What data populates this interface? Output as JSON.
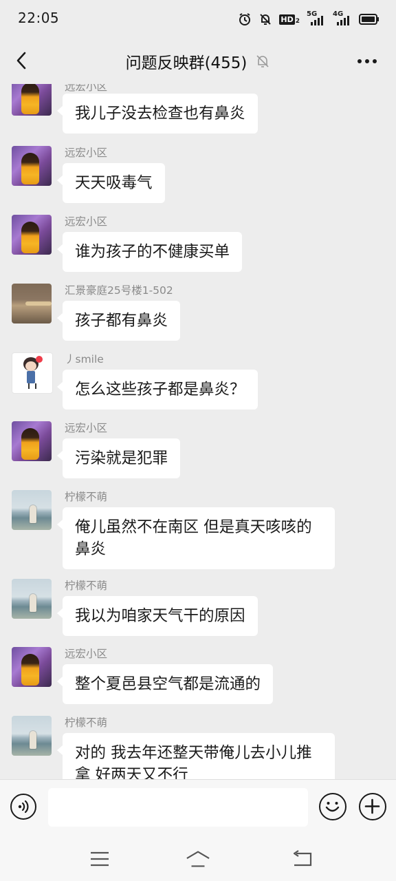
{
  "status_bar": {
    "time": "22:05",
    "icons": [
      "alarm-icon",
      "mute-bell-icon",
      "hd-icon",
      "signal-5g-icon",
      "signal-4g-icon",
      "battery-icon"
    ],
    "hd_label": "HD",
    "hd_sub": "2",
    "net1_label": "5G",
    "net2_label": "4G"
  },
  "header": {
    "title": "问题反映群(455)",
    "muted_icon": "bell-muted-icon",
    "back_icon": "chevron-left-icon",
    "more_icon": "more-dots-icon"
  },
  "messages": [
    {
      "sender": "远宏小区",
      "text": "我儿子没去检查也有鼻炎",
      "avatar": "yuanhong"
    },
    {
      "sender": "远宏小区",
      "text": "天天吸毒气",
      "avatar": "yuanhong"
    },
    {
      "sender": "远宏小区",
      "text": "谁为孩子的不健康买单",
      "avatar": "yuanhong"
    },
    {
      "sender": "汇景豪庭25号楼1-502",
      "text": "孩子都有鼻炎",
      "avatar": "huijing"
    },
    {
      "sender": "丿smile",
      "text": "怎么这些孩子都是鼻炎？",
      "avatar": "smile"
    },
    {
      "sender": "远宏小区",
      "text": "污染就是犯罪",
      "avatar": "yuanhong"
    },
    {
      "sender": "柠檬不萌",
      "text": "俺儿虽然不在南区 但是真天咳咳的 鼻炎",
      "avatar": "ningmeng"
    },
    {
      "sender": "柠檬不萌",
      "text": "我以为咱家天气干的原因",
      "avatar": "ningmeng"
    },
    {
      "sender": "远宏小区",
      "text": "整个夏邑县空气都是流通的",
      "avatar": "yuanhong"
    },
    {
      "sender": "柠檬不萌",
      "text": "对的 我去年还整天带俺儿去小儿推拿 好两天又不行",
      "avatar": "ningmeng"
    }
  ],
  "input_bar": {
    "voice_icon": "voice-icon",
    "input_value": "",
    "emoji_icon": "emoji-icon",
    "plus_icon": "plus-icon"
  },
  "nav_bar": {
    "menu_icon": "menu-icon",
    "home_icon": "home-icon",
    "back_icon": "back-icon"
  },
  "colors": {
    "background": "#ededed",
    "bubble": "#ffffff",
    "sender_text": "#8a8a8a"
  }
}
